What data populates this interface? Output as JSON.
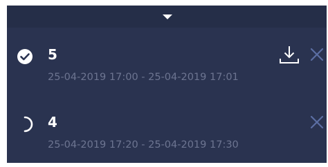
{
  "panel": {
    "collapse_icon": "caret-down-icon"
  },
  "jobs": [
    {
      "number": "5",
      "time_range": "25-04-2019 17:00 - 25-04-2019 17:01",
      "status": "completed",
      "status_icon": "check-circle-icon",
      "actions": [
        "download-icon",
        "close-icon"
      ]
    },
    {
      "number": "4",
      "time_range": "25-04-2019 17:20 - 25-04-2019 17:30",
      "status": "in-progress",
      "status_icon": "loading-spinner-icon",
      "actions": [
        "close-icon"
      ]
    }
  ],
  "colors": {
    "panel_bg": "#2a3350",
    "text_primary": "#ffffff",
    "text_secondary": "#6d7591",
    "close_icon": "#5b6ea3"
  }
}
